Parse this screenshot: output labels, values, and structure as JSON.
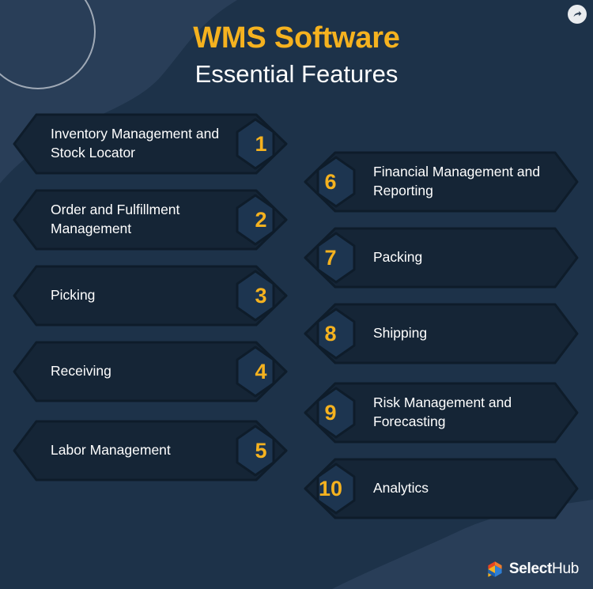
{
  "header": {
    "title": "WMS Software",
    "subtitle": "Essential Features"
  },
  "share_button": {
    "icon": "share-arrow-icon"
  },
  "colors": {
    "background": "#1d3249",
    "background_wave": "#2b415a",
    "card": "#152536",
    "card_stroke": "#0e1c2a",
    "badge": "#1d3550",
    "accent": "#f5b21f",
    "text": "#ffffff"
  },
  "left_column": [
    {
      "number": "1",
      "label": "Inventory Management and Stock Locator"
    },
    {
      "number": "2",
      "label": "Order and Fulfillment Management"
    },
    {
      "number": "3",
      "label": "Picking"
    },
    {
      "number": "4",
      "label": "Receiving"
    },
    {
      "number": "5",
      "label": "Labor Management"
    }
  ],
  "right_column": [
    {
      "number": "6",
      "label": "Financial Management and Reporting"
    },
    {
      "number": "7",
      "label": "Packing"
    },
    {
      "number": "8",
      "label": "Shipping"
    },
    {
      "number": "9",
      "label": "Risk Management and Forecasting"
    },
    {
      "number": "10",
      "label": "Analytics"
    }
  ],
  "logo": {
    "mark": "selecthub-cube-icon",
    "name_bold": "Select",
    "name_light": "Hub"
  }
}
